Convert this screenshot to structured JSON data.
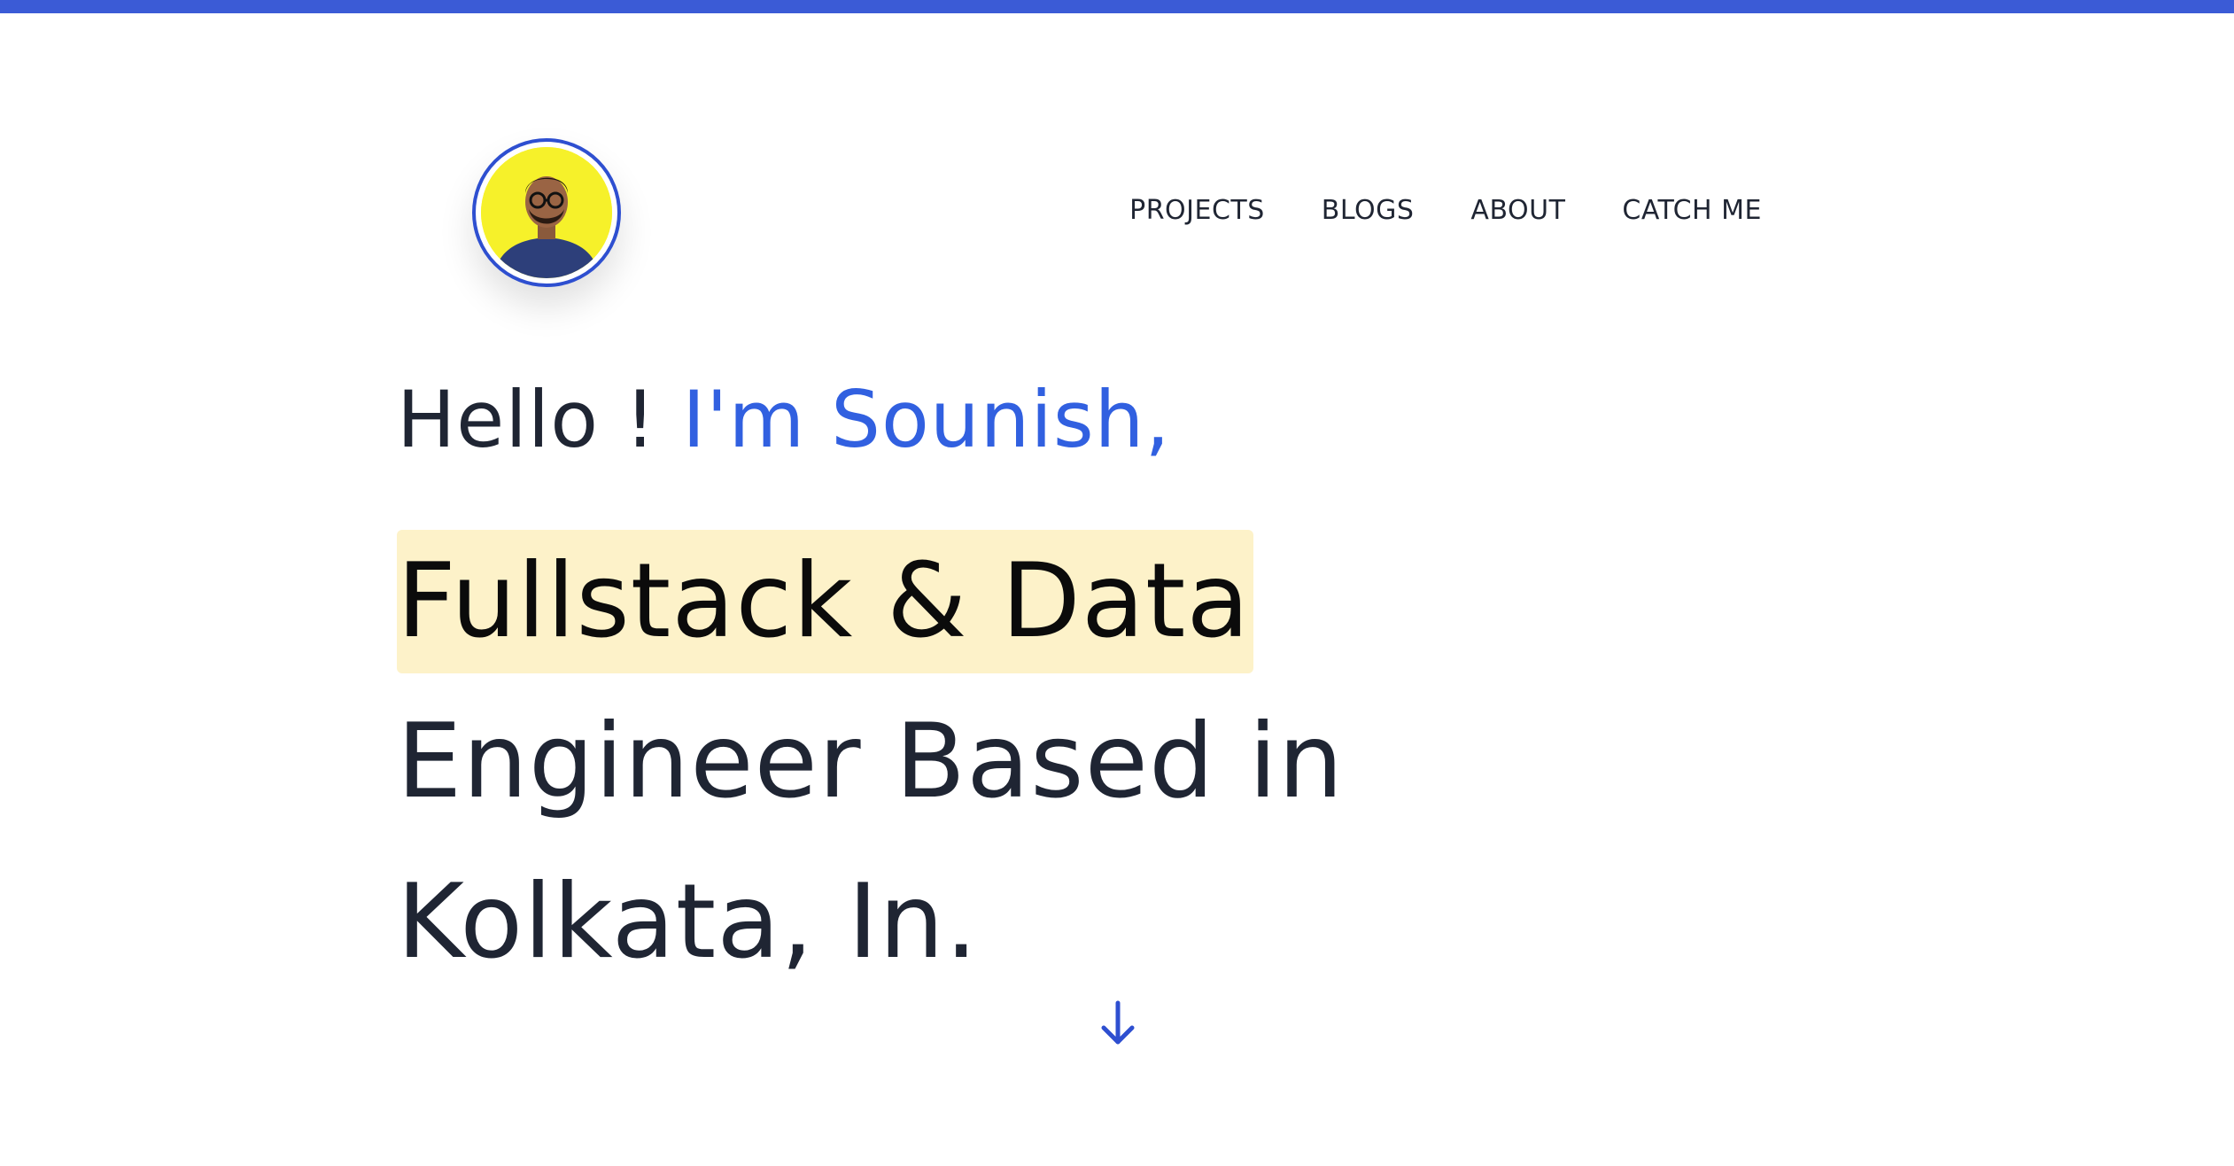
{
  "colors": {
    "accent": "#3b5bd6",
    "name_blue": "#3160e0",
    "highlight_bg": "#fdf2c9",
    "text_dark": "#1f2533",
    "avatar_bg": "#f6f12a"
  },
  "header": {
    "avatar_icon": "profile-photo",
    "nav": [
      {
        "label": "PROJECTS"
      },
      {
        "label": "BLOGS"
      },
      {
        "label": "ABOUT"
      },
      {
        "label": "CATCH ME"
      }
    ]
  },
  "hero": {
    "greeting": "Hello !",
    "name": "I'm Sounish,",
    "highlight": "Fullstack & Data",
    "line2": "Engineer Based in",
    "line3": "Kolkata, In."
  },
  "scroll": {
    "icon": "arrow-down-icon"
  }
}
